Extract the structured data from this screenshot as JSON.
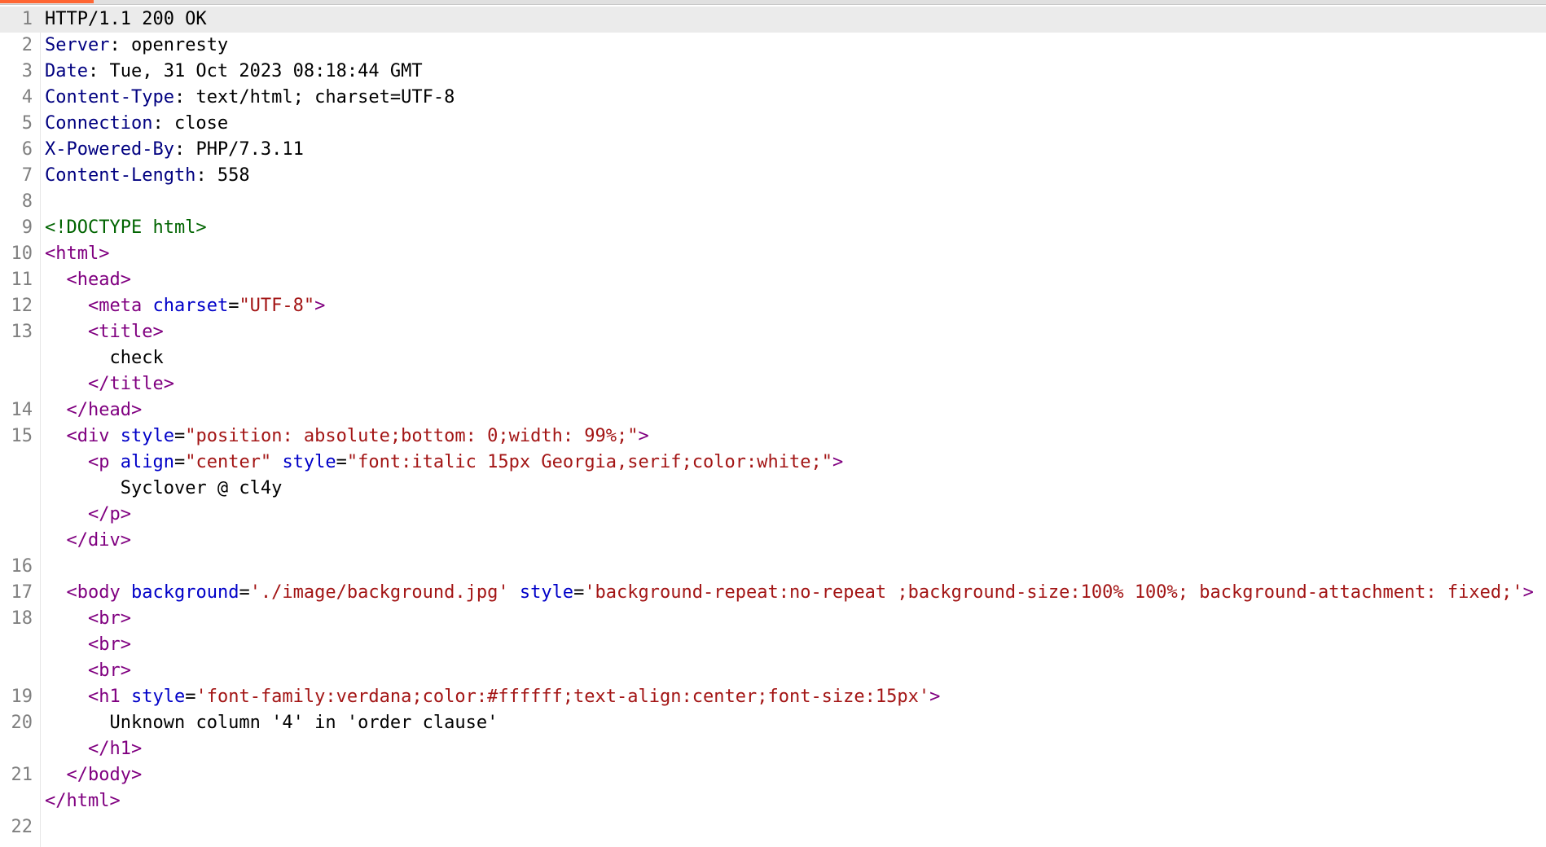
{
  "editor": {
    "lines": [
      {
        "n": "1",
        "indent": "",
        "tokens": [
          {
            "c": "v",
            "t": "HTTP/1.1 200 OK"
          }
        ]
      },
      {
        "n": "2",
        "indent": "",
        "tokens": [
          {
            "c": "k",
            "t": "Server"
          },
          {
            "c": "v",
            "t": ": openresty"
          }
        ]
      },
      {
        "n": "3",
        "indent": "",
        "tokens": [
          {
            "c": "k",
            "t": "Date"
          },
          {
            "c": "v",
            "t": ": Tue, 31 Oct 2023 08:18:44 GMT"
          }
        ]
      },
      {
        "n": "4",
        "indent": "",
        "tokens": [
          {
            "c": "k",
            "t": "Content-Type"
          },
          {
            "c": "v",
            "t": ": text/html; charset=UTF-8"
          }
        ]
      },
      {
        "n": "5",
        "indent": "",
        "tokens": [
          {
            "c": "k",
            "t": "Connection"
          },
          {
            "c": "v",
            "t": ": close"
          }
        ]
      },
      {
        "n": "6",
        "indent": "",
        "tokens": [
          {
            "c": "k",
            "t": "X-Powered-By"
          },
          {
            "c": "v",
            "t": ": PHP/7.3.11"
          }
        ]
      },
      {
        "n": "7",
        "indent": "",
        "tokens": [
          {
            "c": "k",
            "t": "Content-Length"
          },
          {
            "c": "v",
            "t": ": 558"
          }
        ]
      },
      {
        "n": "8",
        "indent": "",
        "tokens": []
      },
      {
        "n": "9",
        "indent": "",
        "tokens": [
          {
            "c": "dt",
            "t": "<!DOCTYPE html>"
          }
        ]
      },
      {
        "n": "10",
        "indent": "",
        "tokens": [
          {
            "c": "br",
            "t": "<"
          },
          {
            "c": "tg",
            "t": "html"
          },
          {
            "c": "br",
            "t": ">"
          }
        ]
      },
      {
        "n": "11",
        "indent": "  ",
        "tokens": [
          {
            "c": "br",
            "t": "<"
          },
          {
            "c": "tg",
            "t": "head"
          },
          {
            "c": "br",
            "t": ">"
          }
        ]
      },
      {
        "n": "12",
        "indent": "    ",
        "tokens": [
          {
            "c": "br",
            "t": "<"
          },
          {
            "c": "tg",
            "t": "meta"
          },
          {
            "c": "t",
            "t": " "
          },
          {
            "c": "at",
            "t": "charset"
          },
          {
            "c": "eq",
            "t": "="
          },
          {
            "c": "s",
            "t": "\"UTF-8\""
          },
          {
            "c": "br",
            "t": ">"
          }
        ]
      },
      {
        "n": "13",
        "indent": "    ",
        "tokens": [
          {
            "c": "br",
            "t": "<"
          },
          {
            "c": "tg",
            "t": "title"
          },
          {
            "c": "br",
            "t": ">"
          }
        ]
      },
      {
        "n": "",
        "indent": "      ",
        "tokens": [
          {
            "c": "t",
            "t": "check"
          }
        ]
      },
      {
        "n": "",
        "indent": "    ",
        "tokens": [
          {
            "c": "br",
            "t": "</"
          },
          {
            "c": "tg",
            "t": "title"
          },
          {
            "c": "br",
            "t": ">"
          }
        ]
      },
      {
        "n": "14",
        "indent": "  ",
        "tokens": [
          {
            "c": "br",
            "t": "</"
          },
          {
            "c": "tg",
            "t": "head"
          },
          {
            "c": "br",
            "t": ">"
          }
        ]
      },
      {
        "n": "15",
        "indent": "  ",
        "tokens": [
          {
            "c": "br",
            "t": "<"
          },
          {
            "c": "tg",
            "t": "div"
          },
          {
            "c": "t",
            "t": " "
          },
          {
            "c": "at",
            "t": "style"
          },
          {
            "c": "eq",
            "t": "="
          },
          {
            "c": "s",
            "t": "\"position: absolute;bottom: 0;width: 99%;\""
          },
          {
            "c": "br",
            "t": ">"
          }
        ]
      },
      {
        "n": "",
        "indent": "    ",
        "tokens": [
          {
            "c": "br",
            "t": "<"
          },
          {
            "c": "tg",
            "t": "p"
          },
          {
            "c": "t",
            "t": " "
          },
          {
            "c": "at",
            "t": "align"
          },
          {
            "c": "eq",
            "t": "="
          },
          {
            "c": "s",
            "t": "\"center\""
          },
          {
            "c": "t",
            "t": " "
          },
          {
            "c": "at",
            "t": "style"
          },
          {
            "c": "eq",
            "t": "="
          },
          {
            "c": "s",
            "t": "\"font:italic 15px Georgia,serif;color:white;\""
          },
          {
            "c": "br",
            "t": ">"
          }
        ]
      },
      {
        "n": "",
        "indent": "      ",
        "tokens": [
          {
            "c": "t",
            "t": " Syclover @ cl4y"
          }
        ]
      },
      {
        "n": "",
        "indent": "    ",
        "tokens": [
          {
            "c": "br",
            "t": "</"
          },
          {
            "c": "tg",
            "t": "p"
          },
          {
            "c": "br",
            "t": ">"
          }
        ]
      },
      {
        "n": "",
        "indent": "  ",
        "tokens": [
          {
            "c": "br",
            "t": "</"
          },
          {
            "c": "tg",
            "t": "div"
          },
          {
            "c": "br",
            "t": ">"
          }
        ]
      },
      {
        "n": "16",
        "indent": "",
        "tokens": []
      },
      {
        "n": "17",
        "indent": "  ",
        "tokens": [
          {
            "c": "br",
            "t": "<"
          },
          {
            "c": "tg",
            "t": "body"
          },
          {
            "c": "t",
            "t": " "
          },
          {
            "c": "at",
            "t": "background"
          },
          {
            "c": "eq",
            "t": "="
          },
          {
            "c": "s",
            "t": "'./image/background.jpg'"
          },
          {
            "c": "t",
            "t": " "
          },
          {
            "c": "at",
            "t": "style"
          },
          {
            "c": "eq",
            "t": "="
          },
          {
            "c": "s",
            "t": "'background-repeat:no-repeat ;background-size:100% 100%; background-attachment: fixed;'"
          },
          {
            "c": "br",
            "t": ">"
          }
        ]
      },
      {
        "n": "18",
        "indent": "    ",
        "tokens": [
          {
            "c": "br",
            "t": "<"
          },
          {
            "c": "tg",
            "t": "br"
          },
          {
            "c": "br",
            "t": ">"
          }
        ]
      },
      {
        "n": "",
        "indent": "    ",
        "tokens": [
          {
            "c": "br",
            "t": "<"
          },
          {
            "c": "tg",
            "t": "br"
          },
          {
            "c": "br",
            "t": ">"
          }
        ]
      },
      {
        "n": "",
        "indent": "    ",
        "tokens": [
          {
            "c": "br",
            "t": "<"
          },
          {
            "c": "tg",
            "t": "br"
          },
          {
            "c": "br",
            "t": ">"
          }
        ]
      },
      {
        "n": "19",
        "indent": "    ",
        "tokens": [
          {
            "c": "br",
            "t": "<"
          },
          {
            "c": "tg",
            "t": "h1"
          },
          {
            "c": "t",
            "t": " "
          },
          {
            "c": "at",
            "t": "style"
          },
          {
            "c": "eq",
            "t": "="
          },
          {
            "c": "s",
            "t": "'font-family:verdana;color:#ffffff;text-align:center;font-size:15px'"
          },
          {
            "c": "br",
            "t": ">"
          }
        ]
      },
      {
        "n": "20",
        "indent": "      ",
        "tokens": [
          {
            "c": "t",
            "t": "Unknown column '4' in 'order clause'"
          }
        ]
      },
      {
        "n": "",
        "indent": "    ",
        "tokens": [
          {
            "c": "br",
            "t": "</"
          },
          {
            "c": "tg",
            "t": "h1"
          },
          {
            "c": "br",
            "t": ">"
          }
        ]
      },
      {
        "n": "21",
        "indent": "  ",
        "tokens": [
          {
            "c": "br",
            "t": "</"
          },
          {
            "c": "tg",
            "t": "body"
          },
          {
            "c": "br",
            "t": ">"
          }
        ]
      },
      {
        "n": "",
        "indent": "",
        "tokens": [
          {
            "c": "br",
            "t": "</"
          },
          {
            "c": "tg",
            "t": "html"
          },
          {
            "c": "br",
            "t": ">"
          }
        ]
      },
      {
        "n": "22",
        "indent": "",
        "tokens": []
      }
    ]
  }
}
